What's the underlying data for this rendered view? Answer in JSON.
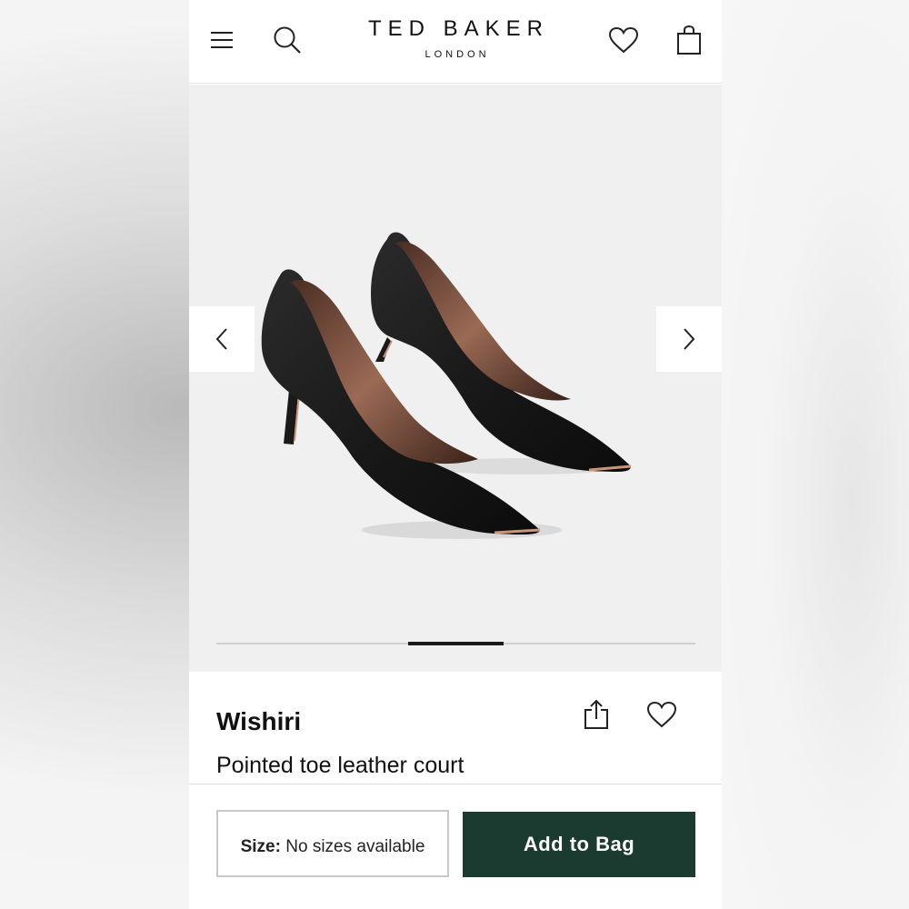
{
  "header": {
    "brand_name": "TED BAKER",
    "brand_sub": "LONDON",
    "icons": [
      "menu-icon",
      "search-icon",
      "heart-icon",
      "bag-icon"
    ]
  },
  "gallery": {
    "image_alt": "Black pointed toe court shoes",
    "progress": {
      "current": 3,
      "total": 5
    },
    "icons": [
      "chevron-left-icon",
      "chevron-right-icon"
    ]
  },
  "product": {
    "name": "Wishiri",
    "description": "Pointed toe leather court",
    "icons": [
      "share-icon",
      "heart-icon"
    ]
  },
  "purchase": {
    "size_label": "Size:",
    "size_value": "No sizes available",
    "add_to_bag": "Add to Bag",
    "accent_color": "#1b3b30"
  }
}
